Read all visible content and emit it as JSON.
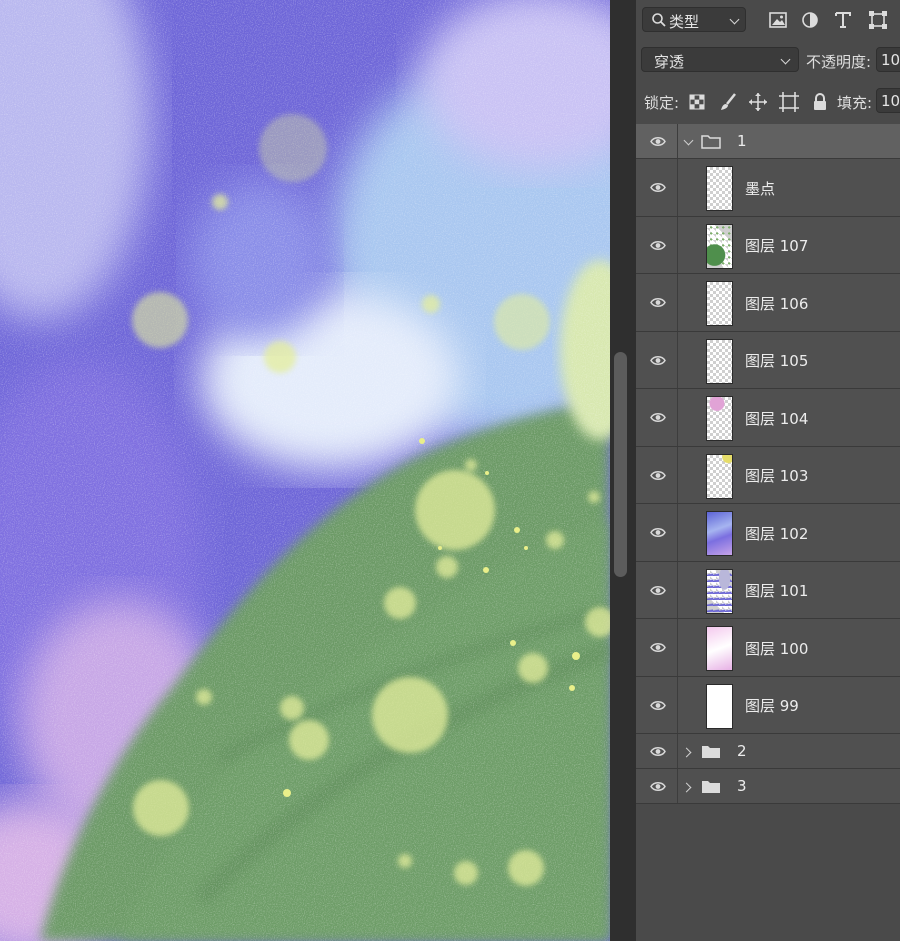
{
  "canvas": {
    "description_colors": {
      "violet": "#6a5fd6",
      "sky": "#a8c6ef",
      "green": "#6a9a64",
      "spot": "#e7ef9a"
    }
  },
  "panel": {
    "filter": {
      "label": "类型"
    },
    "blend_mode": {
      "value": "穿透"
    },
    "opacity": {
      "label": "不透明度:",
      "value": "10"
    },
    "lock": {
      "label": "锁定:"
    },
    "fill": {
      "label": "填充:",
      "value": "10"
    },
    "layers": [
      {
        "name": "1",
        "kind": "group-open"
      },
      {
        "name": "墨点",
        "kind": "layer"
      },
      {
        "name": "图层 107",
        "kind": "layer"
      },
      {
        "name": "图层 106",
        "kind": "layer"
      },
      {
        "name": "图层 105",
        "kind": "layer"
      },
      {
        "name": "图层 104",
        "kind": "layer"
      },
      {
        "name": "图层 103",
        "kind": "layer"
      },
      {
        "name": "图层 102",
        "kind": "layer"
      },
      {
        "name": "图层 101",
        "kind": "layer"
      },
      {
        "name": "图层 100",
        "kind": "layer"
      },
      {
        "name": "图层 99",
        "kind": "layer"
      },
      {
        "name": "2",
        "kind": "group-closed"
      },
      {
        "name": "3",
        "kind": "group-closed"
      }
    ]
  }
}
